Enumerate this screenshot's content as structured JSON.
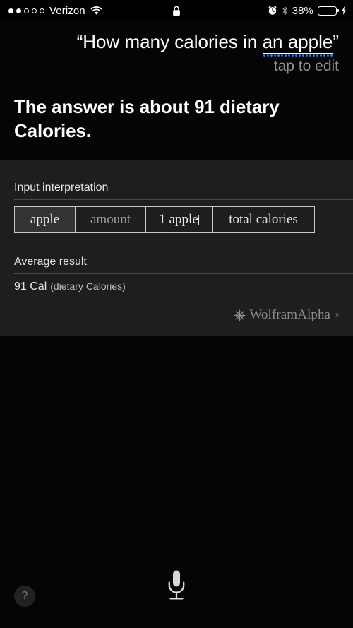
{
  "status_bar": {
    "signal_dots_filled": 2,
    "signal_dots_total": 5,
    "carrier": "Verizon",
    "wifi_icon": "wifi-icon",
    "lock_icon": "lock-icon",
    "alarm_icon": "alarm-clock-icon",
    "bluetooth_icon": "bluetooth-icon",
    "battery_percent_label": "38%",
    "battery_level": 38,
    "battery_color": "#f8c323",
    "charging_icon": "lightning-bolt-icon"
  },
  "query": {
    "open_quote": "“",
    "prefix": "How many calories in ",
    "editable_term": "an apple",
    "close_quote": "”",
    "edit_hint": "tap to edit",
    "underline_color": "#1f7ef6"
  },
  "answer": {
    "text": "The answer is about 91 dietary Calories."
  },
  "card": {
    "input_interpretation": {
      "title": "Input interpretation",
      "cells": [
        {
          "label": "apple",
          "style": "highlight"
        },
        {
          "label": "amount",
          "style": "dim"
        },
        {
          "label": "1 apple",
          "style": "caret"
        },
        {
          "label": "total calories",
          "style": "normal"
        }
      ]
    },
    "average_result": {
      "title": "Average result",
      "value": "91 Cal",
      "unit": "(dietary Calories)"
    },
    "brand": {
      "mark": "wolfram-spikey-icon",
      "name": "WolframAlpha",
      "trademark": "®"
    }
  },
  "controls": {
    "mic_label": "microphone-icon",
    "help_label": "?"
  }
}
